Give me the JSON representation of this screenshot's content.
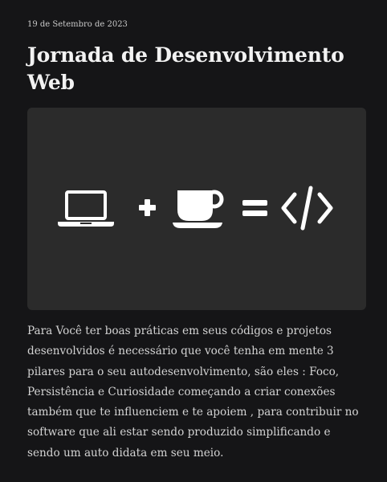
{
  "post": {
    "date": "19 de Setembro de 2023",
    "title": "Jornada de Desenvolvimento Web",
    "body": "Para Você ter boas práticas em seus códigos e projetos desenvolvidos é necessário que você tenha em mente 3 pilares para o seu autodesenvolvimento, são eles : Foco, Persistência e Curiosidade começando a criar conexões também que te influenciem e te apoiem , para contribuir no software que ali estar sendo produzido simplificando e sendo um auto didata em seu meio."
  },
  "hero": {
    "icons": [
      "laptop-icon",
      "plus-icon",
      "coffee-cup-icon",
      "equals-icon",
      "code-icon"
    ],
    "background": "#2b2b2b",
    "icon_color": "#ffffff"
  },
  "colors": {
    "page_background": "#151517",
    "title": "#f2f2f2",
    "text": "#d3d3d3"
  }
}
